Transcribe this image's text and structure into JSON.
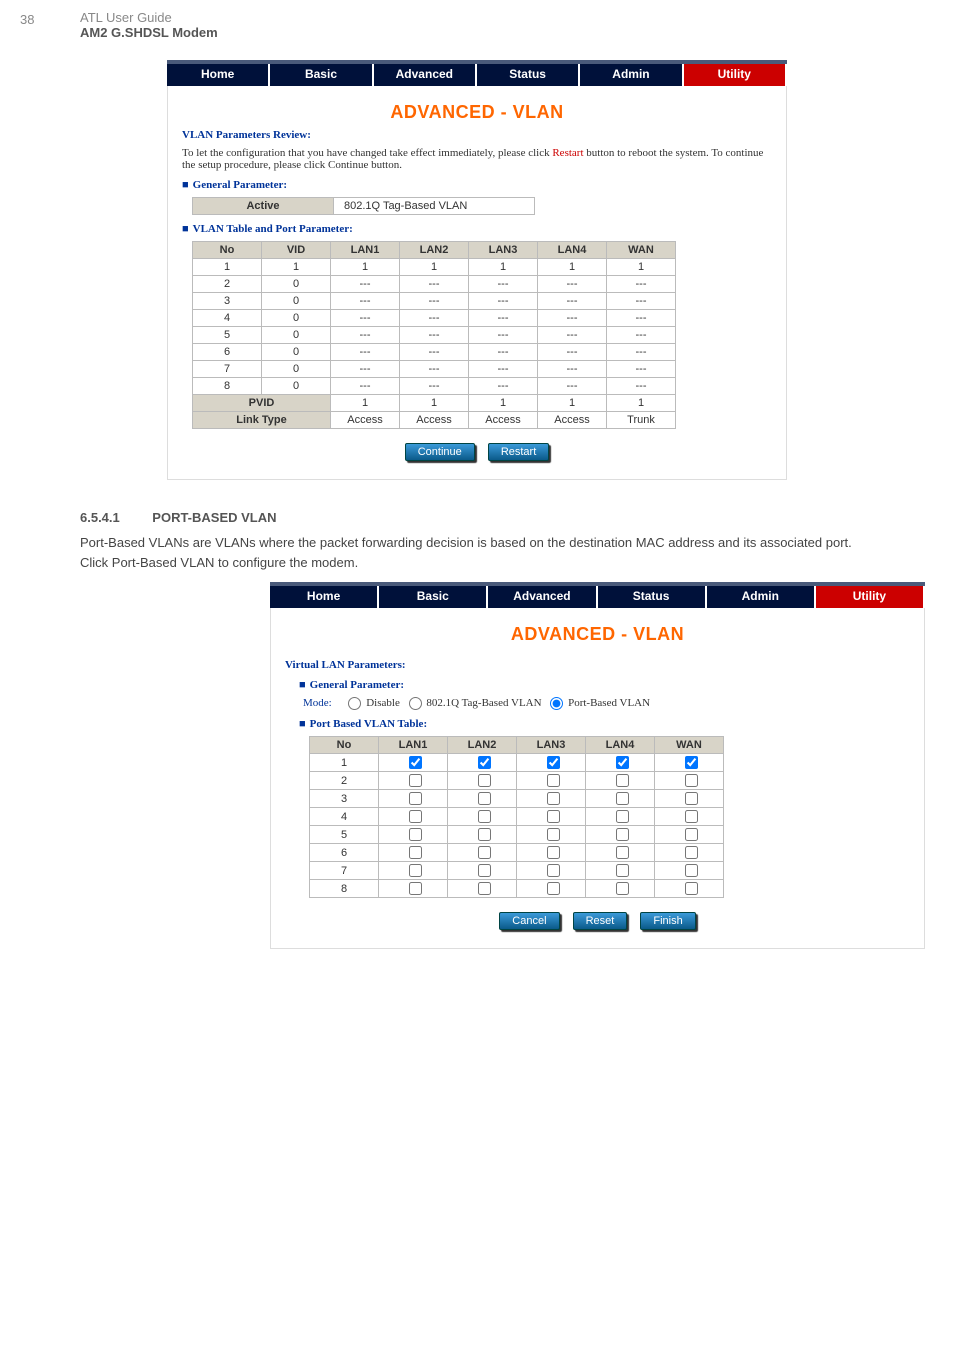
{
  "doc": {
    "page_number": "38",
    "title_line1": "ATL User Guide",
    "title_line2": "AM2 G.SHDSL Modem"
  },
  "nav": {
    "home": "Home",
    "basic": "Basic",
    "advanced": "Advanced",
    "status": "Status",
    "admin": "Admin",
    "utility": "Utility"
  },
  "screen1": {
    "page_title": "ADVANCED - VLAN",
    "review_heading": "VLAN Parameters Review:",
    "review_text_1": "To let the configuration that you have changed take effect immediately, please click ",
    "review_restart": "Restart",
    "review_text_2": " button to reboot the system. To continue the setup procedure, please click ",
    "review_continue": "Continue",
    "review_text_3": " button.",
    "gp_heading": "General Parameter:",
    "gp_active": "Active",
    "gp_value": "802.1Q Tag-Based VLAN",
    "vt_heading": "VLAN Table and Port Parameter:",
    "cols": {
      "no": "No",
      "vid": "VID",
      "lan1": "LAN1",
      "lan2": "LAN2",
      "lan3": "LAN3",
      "lan4": "LAN4",
      "wan": "WAN"
    },
    "rows": [
      {
        "no": "1",
        "vid": "1",
        "lan1": "1",
        "lan2": "1",
        "lan3": "1",
        "lan4": "1",
        "wan": "1"
      },
      {
        "no": "2",
        "vid": "0",
        "lan1": "---",
        "lan2": "---",
        "lan3": "---",
        "lan4": "---",
        "wan": "---"
      },
      {
        "no": "3",
        "vid": "0",
        "lan1": "---",
        "lan2": "---",
        "lan3": "---",
        "lan4": "---",
        "wan": "---"
      },
      {
        "no": "4",
        "vid": "0",
        "lan1": "---",
        "lan2": "---",
        "lan3": "---",
        "lan4": "---",
        "wan": "---"
      },
      {
        "no": "5",
        "vid": "0",
        "lan1": "---",
        "lan2": "---",
        "lan3": "---",
        "lan4": "---",
        "wan": "---"
      },
      {
        "no": "6",
        "vid": "0",
        "lan1": "---",
        "lan2": "---",
        "lan3": "---",
        "lan4": "---",
        "wan": "---"
      },
      {
        "no": "7",
        "vid": "0",
        "lan1": "---",
        "lan2": "---",
        "lan3": "---",
        "lan4": "---",
        "wan": "---"
      },
      {
        "no": "8",
        "vid": "0",
        "lan1": "---",
        "lan2": "---",
        "lan3": "---",
        "lan4": "---",
        "wan": "---"
      }
    ],
    "pvid_label": "PVID",
    "pvid": {
      "lan1": "1",
      "lan2": "1",
      "lan3": "1",
      "lan4": "1",
      "wan": "1"
    },
    "linktype_label": "Link Type",
    "linktype": {
      "lan1": "Access",
      "lan2": "Access",
      "lan3": "Access",
      "lan4": "Access",
      "wan": "Trunk"
    },
    "btn_continue": "Continue",
    "btn_restart": "Restart"
  },
  "body": {
    "sec_heading_num": "6.5.4.1",
    "sec_heading_title": "PORT-BASED VLAN",
    "para1": "Port-Based VLANs are VLANs where the packet forwarding decision is based on the destination MAC address and its associated port.",
    "para2": "Click Port-Based VLAN to configure the modem."
  },
  "screen2": {
    "page_title": "ADVANCED - VLAN",
    "vlp_heading": "Virtual LAN Parameters:",
    "gp_heading": "General Parameter:",
    "mode_label": "Mode:",
    "mode_disable": "Disable",
    "mode_tag": "802.1Q Tag-Based VLAN",
    "mode_port": "Port-Based VLAN",
    "pbt_heading": "Port Based VLAN Table:",
    "cols": {
      "no": "No",
      "lan1": "LAN1",
      "lan2": "LAN2",
      "lan3": "LAN3",
      "lan4": "LAN4",
      "wan": "WAN"
    },
    "rows": [
      {
        "no": "1",
        "lan1": true,
        "lan2": true,
        "lan3": true,
        "lan4": true,
        "wan": true
      },
      {
        "no": "2",
        "lan1": false,
        "lan2": false,
        "lan3": false,
        "lan4": false,
        "wan": false
      },
      {
        "no": "3",
        "lan1": false,
        "lan2": false,
        "lan3": false,
        "lan4": false,
        "wan": false
      },
      {
        "no": "4",
        "lan1": false,
        "lan2": false,
        "lan3": false,
        "lan4": false,
        "wan": false
      },
      {
        "no": "5",
        "lan1": false,
        "lan2": false,
        "lan3": false,
        "lan4": false,
        "wan": false
      },
      {
        "no": "6",
        "lan1": false,
        "lan2": false,
        "lan3": false,
        "lan4": false,
        "wan": false
      },
      {
        "no": "7",
        "lan1": false,
        "lan2": false,
        "lan3": false,
        "lan4": false,
        "wan": false
      },
      {
        "no": "8",
        "lan1": false,
        "lan2": false,
        "lan3": false,
        "lan4": false,
        "wan": false
      }
    ],
    "btn_cancel": "Cancel",
    "btn_reset": "Reset",
    "btn_finish": "Finish"
  }
}
